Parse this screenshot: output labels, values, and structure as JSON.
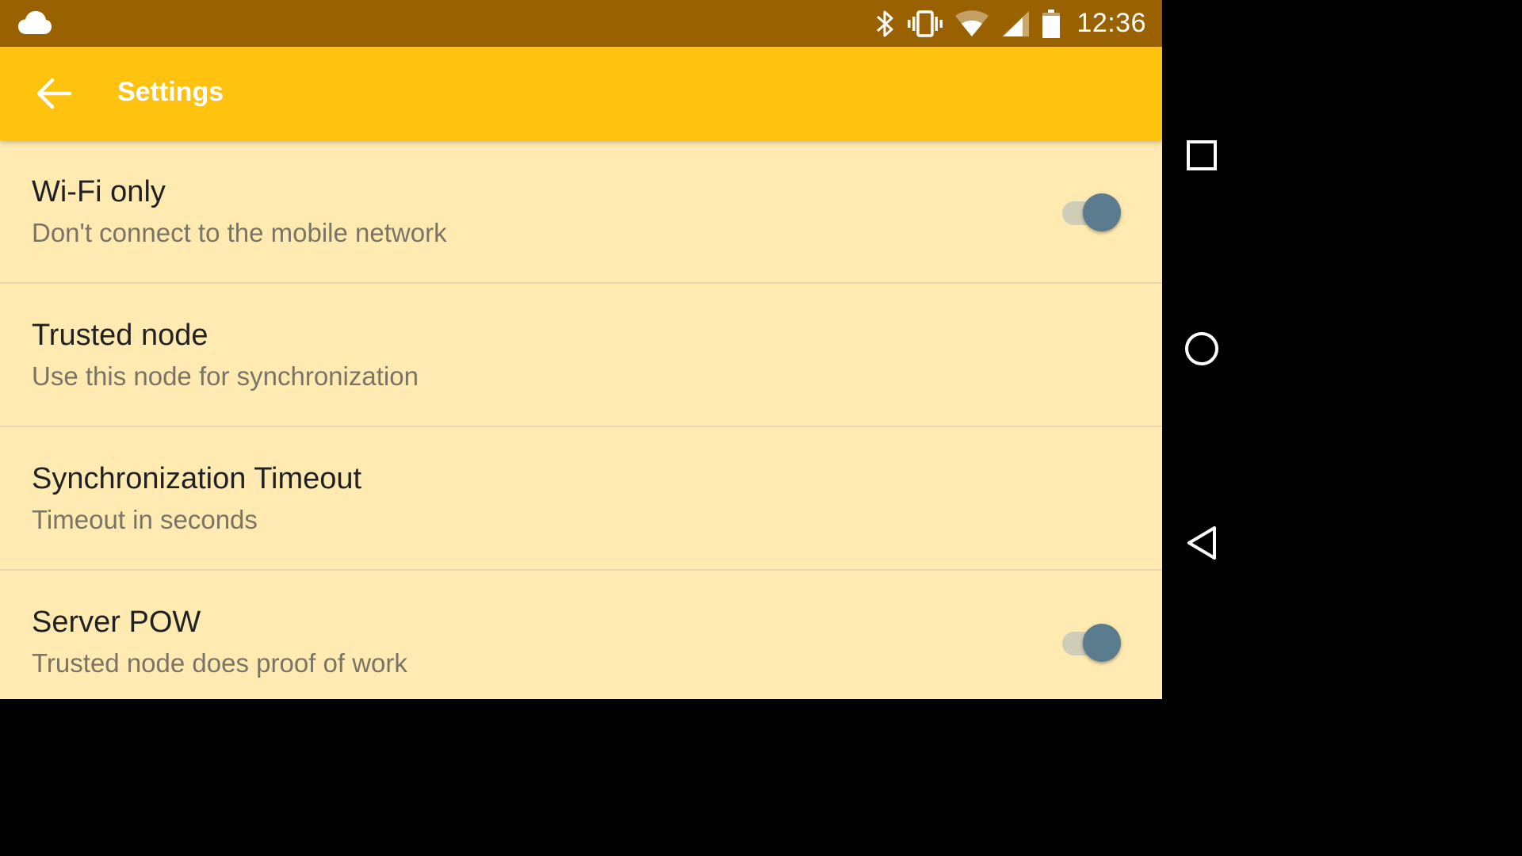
{
  "status_bar": {
    "time": "12:36",
    "left_icons": [
      "cloud-icon"
    ],
    "right_icons": [
      "bluetooth-icon",
      "vibrate-icon",
      "wifi-icon",
      "cell-signal-icon",
      "battery-icon"
    ],
    "color": "#9a6100"
  },
  "app_bar": {
    "title": "Settings",
    "back_icon": "arrow-back-icon",
    "color": "#ffc20e"
  },
  "settings": [
    {
      "title": "Wi-Fi only",
      "summary": "Don't connect to the mobile network",
      "has_switch": true,
      "switch_on": true
    },
    {
      "title": "Trusted node",
      "summary": "Use this node for synchronization",
      "has_switch": false
    },
    {
      "title": "Synchronization Timeout",
      "summary": "Timeout in seconds",
      "has_switch": false
    },
    {
      "title": "Server POW",
      "summary": "Trusted node does proof of work",
      "has_switch": true,
      "switch_on": true
    }
  ],
  "nav_bar": {
    "buttons": [
      "recents-icon",
      "home-icon",
      "back-triangle-icon"
    ]
  },
  "colors": {
    "list_background": "#ffeab2",
    "switch_thumb": "#5b7b8f",
    "switch_track": "#cfccb8"
  }
}
